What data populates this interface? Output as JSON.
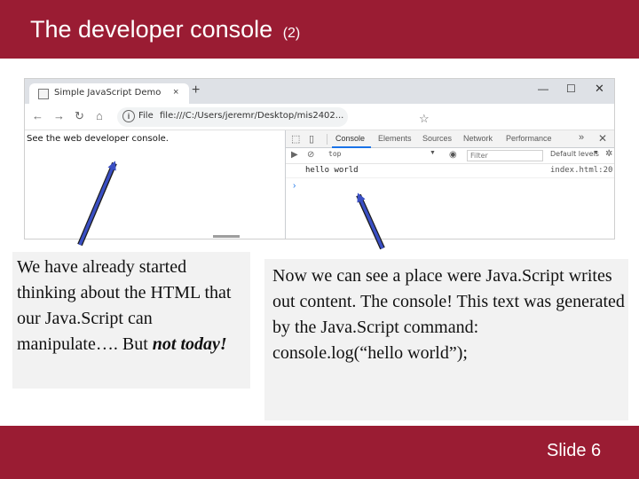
{
  "slide": {
    "title": "The developer console",
    "title_suffix": "(2)",
    "slide_number": "Slide 6"
  },
  "browser": {
    "tab_title": "Simple JavaScript Demo",
    "tab_close": "×",
    "new_tab": "+",
    "window_controls": {
      "minimize": "—",
      "maximize": "☐",
      "close": "✕"
    },
    "nav": {
      "back": "←",
      "forward": "→",
      "reload": "↻",
      "home": "⌂"
    },
    "address": {
      "info": "i",
      "scheme": "File",
      "url": "file:///C:/Users/jeremr/Desktop/mis2402...",
      "star": "☆"
    },
    "page_text": "See the web developer console."
  },
  "devtools": {
    "inspect_icon": "⬚",
    "device_icon": "▯",
    "tabs": [
      "Console",
      "Elements",
      "Sources",
      "Network",
      "Performance"
    ],
    "more": "»",
    "close": "✕",
    "console_bar": {
      "clear_icon": "⊘",
      "context": "top",
      "context_caret": "▼",
      "eye_icon": "◉",
      "filter_placeholder": "Filter",
      "levels": "Default levels",
      "levels_caret": "▼",
      "settings_icon": "✲"
    },
    "log": {
      "message": "hello world",
      "source": "index.html:20"
    },
    "prompt": "›"
  },
  "callouts": {
    "left": {
      "text": "We have already started thinking about the HTML that our Java.Script can manipulate…. But ",
      "emphasis": "not today!"
    },
    "right": {
      "line1": "Now we can see a place were Java.Script writes out content.  The console! This text was generated by the Java.Script command:",
      "code": "console.log(“hello world”);"
    }
  },
  "colors": {
    "brand": "#9a1c33",
    "arrow": "#3a4fc4",
    "callout_bg": "#f2f2f2",
    "devtools_accent": "#1a73e8"
  }
}
